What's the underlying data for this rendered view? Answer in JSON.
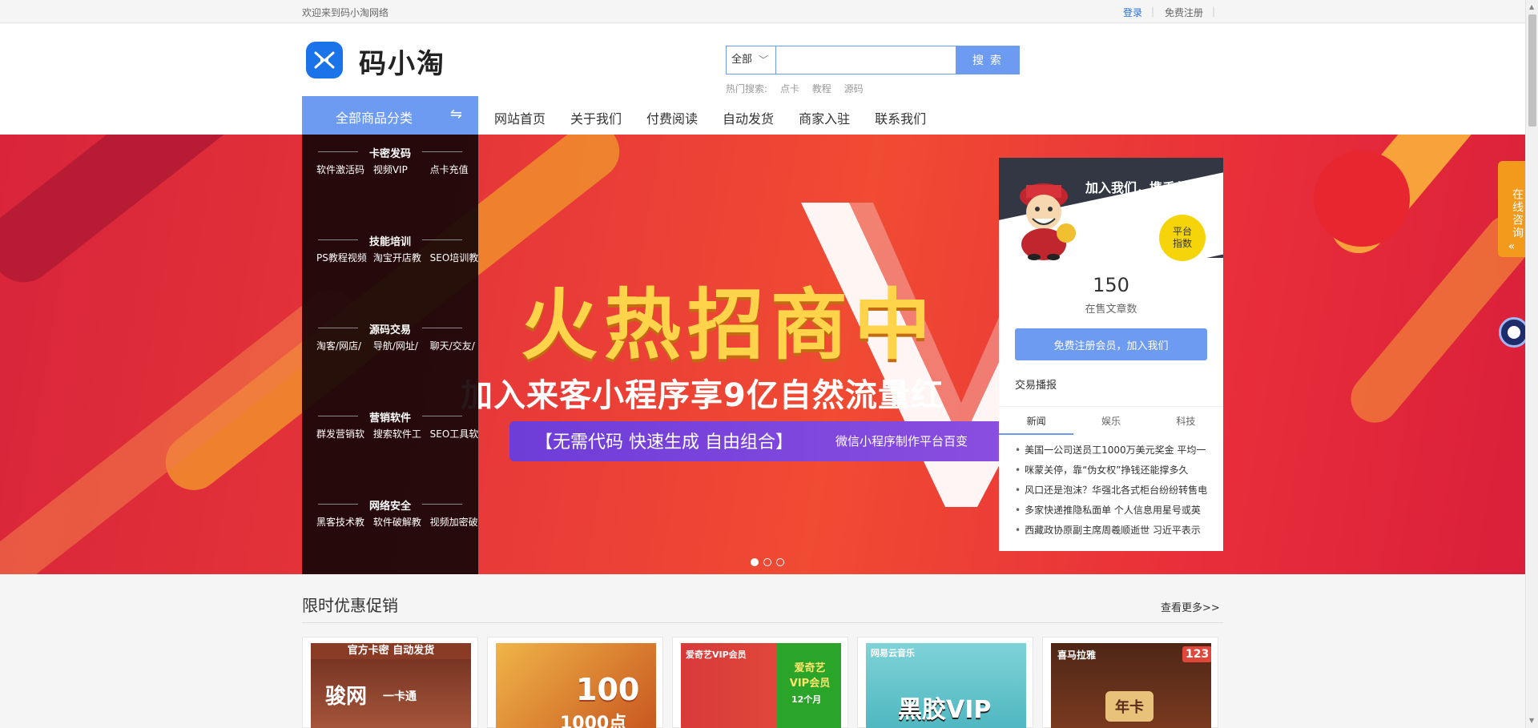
{
  "topbar": {
    "welcome": "欢迎来到码小淘网络",
    "login": "登录",
    "separator": "|",
    "register": "免费注册"
  },
  "header": {
    "site_name": "码小淘",
    "search": {
      "category": "全部",
      "placeholder": "",
      "button": "搜 索"
    },
    "hot_label": "热门搜索:",
    "hot_terms": [
      "点卡",
      "教程",
      "源码"
    ]
  },
  "nav": {
    "all_categories": "全部商品分类",
    "switch_icon": "⇋",
    "links": [
      "网站首页",
      "关于我们",
      "付费阅读",
      "自动发货",
      "商家入驻",
      "联系我们"
    ]
  },
  "category_menu": [
    {
      "title": "卡密发码",
      "items": [
        "软件激活码",
        "视频VIP",
        "点卡充值"
      ]
    },
    {
      "title": "技能培训",
      "items": [
        "PS教程视频",
        "淘宝开店教",
        "SEO培训教"
      ]
    },
    {
      "title": "源码交易",
      "items": [
        "淘客/网店/",
        "导航/网址/",
        "聊天/交友/"
      ]
    },
    {
      "title": "营销软件",
      "items": [
        "群发营销软",
        "搜索软件工",
        "SEO工具软"
      ]
    },
    {
      "title": "网络安全",
      "items": [
        "黑客技术教",
        "软件破解教",
        "视频加密破"
      ]
    }
  ],
  "banner": {
    "headline": "火热招商中",
    "subline": "加入来客小程序享9亿自然流量红",
    "slogan": "【无需代码  快速生成  自由组合】",
    "slogan_right": "微信小程序制作平台百变",
    "slide_count": 3,
    "active_slide": 1
  },
  "panel": {
    "join_text": "加入我们，携手共赢",
    "badge_line1": "平台",
    "badge_line2": "指数",
    "article_count": "150",
    "article_label": "在售文章数",
    "register_button": "免费注册会员，加入我们",
    "trade_label": "交易播报",
    "tabs": [
      "新闻",
      "娱乐",
      "科技"
    ],
    "active_tab": "新闻",
    "news": [
      "美国一公司送员工1000万美元奖金 平均一",
      "咪蒙关停，靠“伪女权”挣钱还能撑多久",
      "风口还是泡沫？华强北各式柜台纷纷转售电",
      "多家快递推隐私面单 个人信息用星号或英",
      "西藏政协原副主席周羲顺逝世 习近平表示"
    ]
  },
  "side": {
    "consult": "在线咨询",
    "collapse": "«"
  },
  "promo": {
    "title": "限时优惠促销",
    "more": "查看更多>>",
    "cards": [
      {
        "label_top": "官方卡密 自动发货",
        "label_main": "骏网",
        "label_sub": "一卡通",
        "bg": "#7a3a28"
      },
      {
        "label_top": "",
        "label_main": "100",
        "label_sub": "1000点",
        "bg": "#e9a93a"
      },
      {
        "label_top": "爱奇艺VIP会员",
        "label_main": "爱奇艺 VIP会员",
        "label_sub": "12个月",
        "bg": "#c92b2b"
      },
      {
        "label_top": "网易云音乐",
        "label_main": "黑胶VIP",
        "label_sub": "",
        "bg": "#5cc3cc"
      },
      {
        "label_top": "喜马拉雅",
        "label_main": "年卡",
        "label_sub": "123",
        "bg": "#5a2a1a"
      }
    ]
  },
  "colors": {
    "accent": "#6d9bf1",
    "banner_red": "#e83a38",
    "headline_yellow": "#ffd34a",
    "panel_dark": "#333744",
    "consult_orange": "#f39a1d"
  }
}
